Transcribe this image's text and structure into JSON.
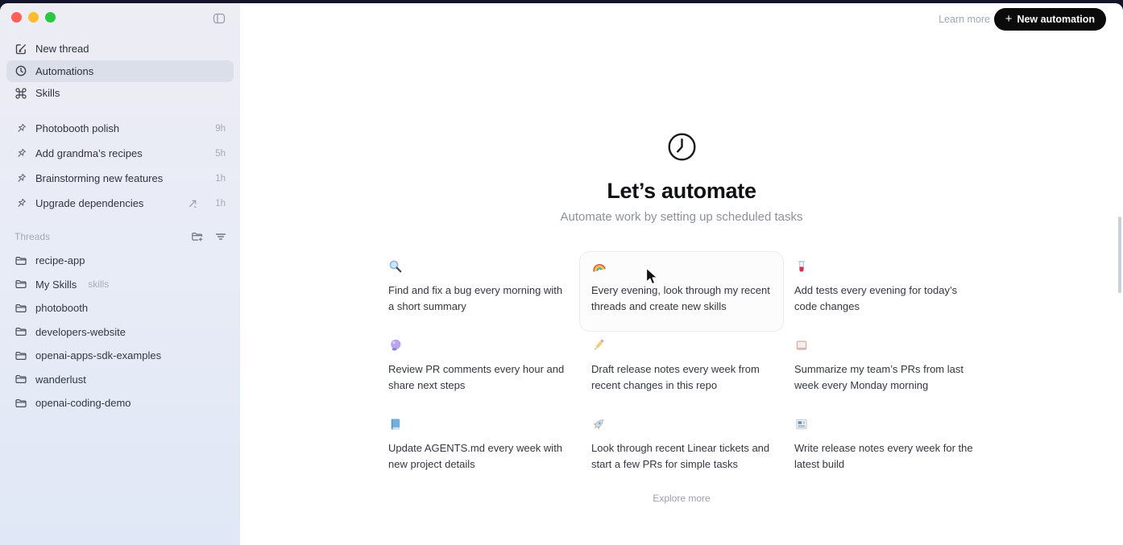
{
  "window": {
    "traffic_lights": [
      "close",
      "minimize",
      "zoom"
    ]
  },
  "sidebar": {
    "nav": [
      {
        "label": "New thread",
        "icon": "compose-icon"
      },
      {
        "label": "Automations",
        "icon": "clock-icon",
        "selected": true
      },
      {
        "label": "Skills",
        "icon": "command-icon"
      }
    ],
    "recents": [
      {
        "icon": "pin-icon",
        "label": "Photobooth polish",
        "time": "9h"
      },
      {
        "icon": "pin-icon",
        "label": "Add grandma’s recipes",
        "time": "5h"
      },
      {
        "icon": "pin-icon",
        "label": "Brainstorming new features",
        "time": "1h"
      },
      {
        "icon": "pin-icon",
        "label": "Upgrade dependencies",
        "time": "1h",
        "shared": true
      }
    ],
    "threads_header": "Threads",
    "threads_header_icons": [
      "folder-plus-icon",
      "filter-icon"
    ],
    "threads": [
      {
        "icon": "folder-icon",
        "label": "recipe-app"
      },
      {
        "icon": "folder-icon",
        "label": "My Skills",
        "badge": "skills"
      },
      {
        "icon": "folder-icon",
        "label": "photobooth"
      },
      {
        "icon": "folder-icon",
        "label": "developers-website"
      },
      {
        "icon": "folder-icon",
        "label": "openai-apps-sdk-examples"
      },
      {
        "icon": "folder-icon",
        "label": "wanderlust"
      },
      {
        "icon": "folder-icon",
        "label": "openai-coding-demo"
      }
    ]
  },
  "header": {
    "learn_more": "Learn more",
    "plus": "+",
    "new_automation_label": "New automation"
  },
  "hero": {
    "icon": "clock-icon",
    "title": "Let’s automate",
    "subtitle": "Automate work by setting up scheduled tasks"
  },
  "cards": [
    {
      "icon": "magnifier-emoji",
      "text": "Find and fix a bug every morning with a short summary"
    },
    {
      "icon": "rainbow-emoji",
      "text": "Every evening, look through my recent threads and create new skills",
      "hovered": true
    },
    {
      "icon": "test-tube-emoji",
      "text": "Add tests every evening for today’s code changes"
    },
    {
      "icon": "crystal-ball-emoji",
      "text": "Review PR comments every hour and share next steps"
    },
    {
      "icon": "pencil-emoji",
      "text": "Draft release notes every week from recent changes in this repo"
    },
    {
      "icon": "clipboard-emoji",
      "text": "Summarize my team’s PRs from last week every Monday morning"
    },
    {
      "icon": "blue-book-emoji",
      "text": "Update AGENTS.md every week with new project details"
    },
    {
      "icon": "rocket-emoji",
      "text": "Look through recent Linear tickets and start a few PRs for simple tasks"
    },
    {
      "icon": "newspaper-emoji",
      "text": "Write release notes every week for the latest build"
    }
  ],
  "footer": {
    "explore_more": "Explore more"
  },
  "colors": {
    "button_bg": "#0b0b0c",
    "sidebar_selected": "#dbdfea",
    "sidebar_bg_top": "#ededf4",
    "sidebar_bg_bottom": "#e0e7f6",
    "traffic_red": "#ff5f57",
    "traffic_yellow": "#febc2e",
    "traffic_green": "#28c840"
  }
}
